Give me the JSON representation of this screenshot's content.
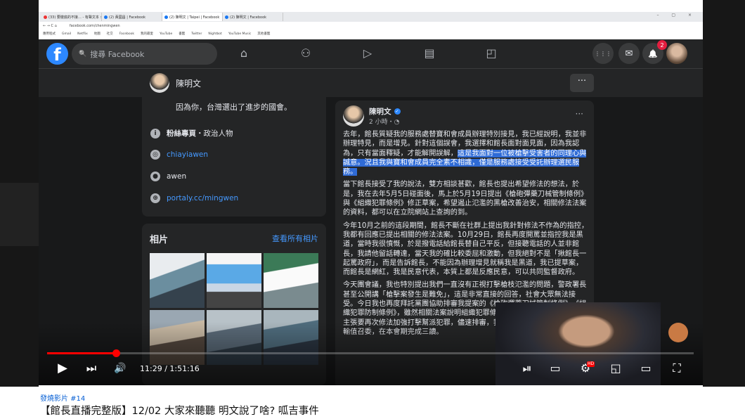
{
  "browser": {
    "tabs": [
      {
        "label": "(33) 要徹底的不接… - 有聲文本 ×",
        "active": false,
        "fav": "red"
      },
      {
        "label": "(2) 黃國昌 | Facebook",
        "active": false,
        "fav": "blue"
      },
      {
        "label": "(2) 陳明文 | Taipei | Facebook",
        "active": true,
        "fav": "blue"
      },
      {
        "label": "(2) 陳明文 | Facebook",
        "active": false,
        "fav": "blue"
      }
    ],
    "url": "facebook.com/chenmingwen",
    "nav_icons": "← → C ⌂",
    "window_controls": "– ▢ ×",
    "bookmarks": [
      "應用程式",
      "Gmail",
      "Netflix",
      "地圖",
      "社交",
      "Facebook",
      "我的最愛",
      "YouTube",
      "書籤",
      "Twitter",
      "Nightbot",
      "YouTube Music",
      "其他書籤"
    ]
  },
  "fb": {
    "logo": "f",
    "search_placeholder": "搜尋 Facebook",
    "search_icon": "🔍",
    "nav": {
      "home": "⌂",
      "friends": "⚇",
      "watch": "▷",
      "marketplace": "▤",
      "groups": "◰"
    },
    "menu_icon": "⋮⋮⋮",
    "messenger_icon": "✉",
    "notif_icon": "🔔",
    "notif_count": "2"
  },
  "page": {
    "name": "陳明文",
    "more": "···",
    "intro_line": "因為你，台灣選出了進步的國會。",
    "info": [
      {
        "icon": "i",
        "bold": "粉絲專頁",
        "text": "・政治人物",
        "link": false
      },
      {
        "icon": "◎",
        "bold": "",
        "text": "chiayiawen",
        "link": true
      },
      {
        "icon": "●",
        "bold": "",
        "text": "awen",
        "link": false
      },
      {
        "icon": "⊕",
        "bold": "",
        "text": "portaly.cc/mingwen",
        "link": true
      }
    ],
    "photos_title": "相片",
    "photos_link": "查看所有相片"
  },
  "post": {
    "author": "陳明文",
    "verified": "✓",
    "time": "2 小時・◔",
    "more": "···",
    "p1_a": "去年，館長質疑我的服務處替寶和會成員辦理特別接見，我已經說明，我並非辦理特見，而是增見。針對這個誤會，我選擇和館長面對面見面，因為我認為，只有當面釋疑，才能解開誤解，",
    "p1_hl": "這是我面對一位被槍擊受害者的同理心與誠意。況且我與寶和會成員完全素不相識，僅是服務處接受受託辦理選民服務。",
    "p2": "當下館長接受了我的說法，雙方相談甚歡，館長也提出希望修法的想法，於是，我在去年5月5日碰面後，馬上於5月19日提出《槍砲彈藥刀械管制條例》與《組織犯罪條例》修正草案，希望遏止氾濫的黑槍改善治安，相關修法法案的資料，都可以在立院網站上查詢的到。",
    "p3": "今年10月之前的這段期間，館長不斷在社群上提出我針對修法不作為的指控，我都有回應已提出相關的修法法案。10月29日，館長再度開罵並指控我是黑道，當時我很憤慨，於是撥電話給館長替自己平反，但接聽電話的人並非館長，我請他留話轉達，當天我的確比較委屈和激動，但我絕對不是「揪館長一起罵政府」，而是告訴館長，不能因為辦理增見就稱我是黑道，我已提草案，而館長是網紅，我是民意代表，本質上都是反應民意，可以共同監督政府。",
    "p4": "今天團會議，我也特別提出我們一直沒有正視打擊槍枝氾濫的問題，警政署長甚至公開講「槍擊案發生是難免」，這是非常直接的回答，社會大眾無法接受。今日我也再度拜託黨團協助排審我提案的《槍砲彈藥刀械管制條例》、《組織犯罪防制條例》，雖然相關法案說明組織犯罪條例）剛修完沒多久，但我仍主張要再次修法加強打擊幫派犯罪，儘速排審，我也希望此案能在這個月協調輸值召委，在本會期完成三讀。"
  },
  "player": {
    "progress": 0.107,
    "time": "11:29 / 1:51:16",
    "play_icon": "▶",
    "next_icon": "⏭",
    "volume_icon": "🔊",
    "autoplay_icon": "⏯",
    "subtitles_icon": "▭",
    "settings_icon": "⚙",
    "settings_badge": "HD",
    "miniplayer_icon": "◱",
    "theater_icon": "▭",
    "fullscreen_icon": "⛶"
  },
  "video": {
    "hashtag": "發燒影片 #14",
    "title": "【館長直播完整版】12/02 大家來聽聽 明文說了啥? 呱吉事件"
  }
}
